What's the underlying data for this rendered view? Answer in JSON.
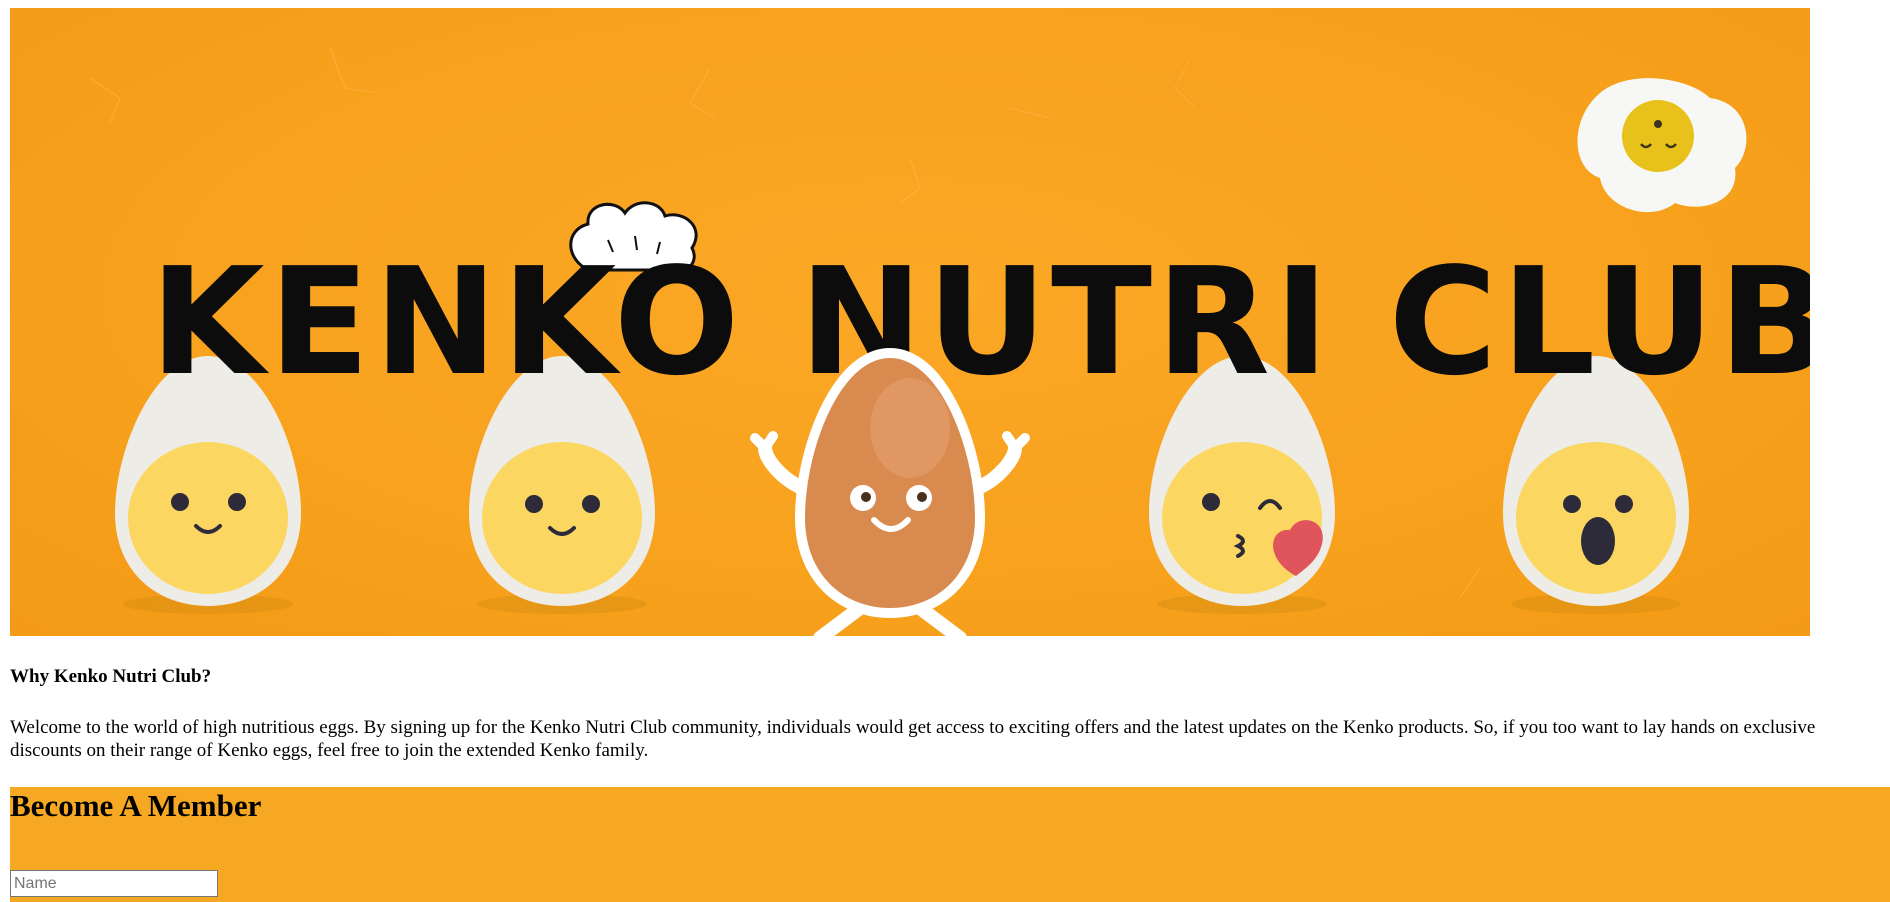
{
  "banner": {
    "title": "KENKO NUTRI CLUB",
    "background_color": "#f8a21e"
  },
  "why": {
    "heading": "Why Kenko Nutri Club?",
    "text": "Welcome to the world of high nutritious eggs. By signing up for the Kenko Nutri Club community, individuals would get access to exciting offers and the latest updates on the Kenko products. So, if you too want to lay hands on exclusive discounts on their range of Kenko eggs, feel free to join the extended Kenko family."
  },
  "member": {
    "heading": "Become A Member",
    "background_color": "#f7a823",
    "name_placeholder": "Name",
    "name_value": ""
  }
}
